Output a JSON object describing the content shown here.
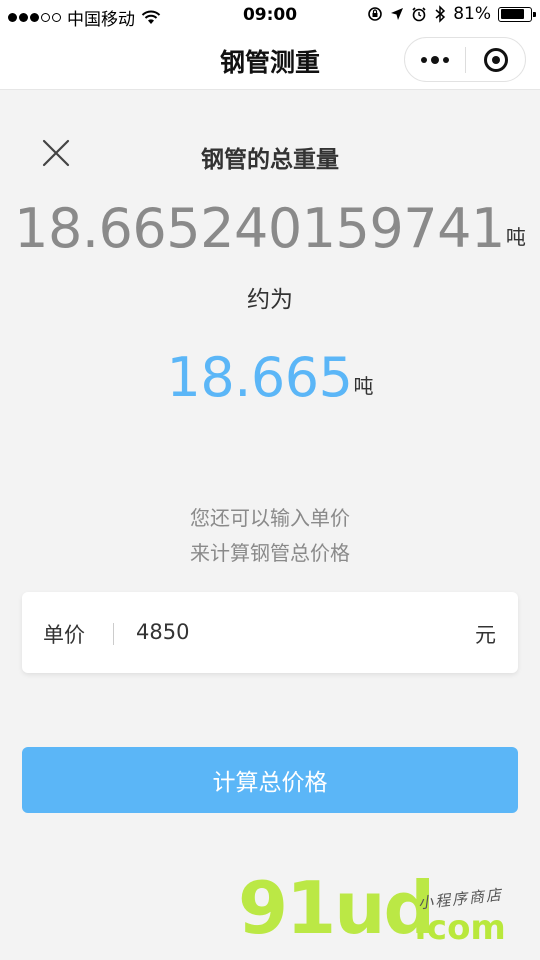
{
  "status_bar": {
    "carrier": "中国移动",
    "time": "09:00",
    "battery_percent": "81%",
    "battery_level": 0.81,
    "icons": [
      "wifi-icon",
      "rotation-lock-icon",
      "location-icon",
      "alarm-icon",
      "bluetooth-icon",
      "battery-icon"
    ]
  },
  "nav": {
    "title": "钢管测重",
    "icons": [
      "more-dots-icon",
      "close-target-icon"
    ]
  },
  "result": {
    "title": "钢管的总重量",
    "weight_full": "18.665240159741",
    "unit": "吨",
    "approx_label": "约为",
    "weight_rounded": "18.665",
    "rounded_color": "#5bb6f7"
  },
  "hint": {
    "line1": "您还可以输入单价",
    "line2": "来计算钢管总价格"
  },
  "price": {
    "label": "单价",
    "value": "4850",
    "unit": "元"
  },
  "calc_button": {
    "label": "计算总价格",
    "color": "#5bb6f7"
  },
  "watermark": {
    "brand": "91ud",
    "domain": ".com",
    "tagline": "小程序商店",
    "color": "#b9e83c"
  }
}
